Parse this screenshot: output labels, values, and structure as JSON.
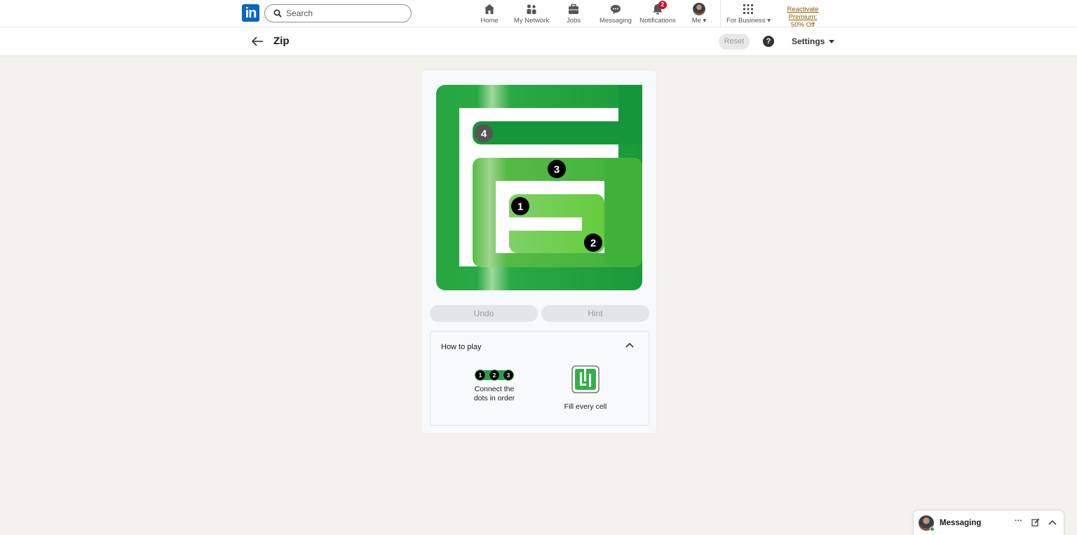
{
  "nav": {
    "logo": "in",
    "search_placeholder": "Search",
    "items": [
      {
        "label": "Home"
      },
      {
        "label": "My Network"
      },
      {
        "label": "Jobs"
      },
      {
        "label": "Messaging"
      },
      {
        "label": "Notifications",
        "badge": "2"
      },
      {
        "label": "Me"
      },
      {
        "label": "For Business"
      }
    ],
    "premium_line1": "Reactivate Premium:",
    "premium_line2": "50% Off"
  },
  "header": {
    "title": "Zip",
    "reset_label": "Reset",
    "help_glyph": "?",
    "settings_label": "Settings"
  },
  "game": {
    "dots": [
      "1",
      "2",
      "3",
      "4"
    ],
    "undo_label": "Undo",
    "hint_label": "Hint",
    "how_to_play": {
      "title": "How to play",
      "rule1_line1": "Connect the",
      "rule1_line2": "dots in order",
      "rule1_dots": [
        "1",
        "2",
        "3"
      ],
      "rule2": "Fill every cell"
    },
    "colors": {
      "path_dark": "#1a9a3a",
      "path_light": "#66cc3e",
      "dot": "#000000"
    }
  },
  "messaging": {
    "label": "Messaging",
    "more_glyph": "···"
  }
}
